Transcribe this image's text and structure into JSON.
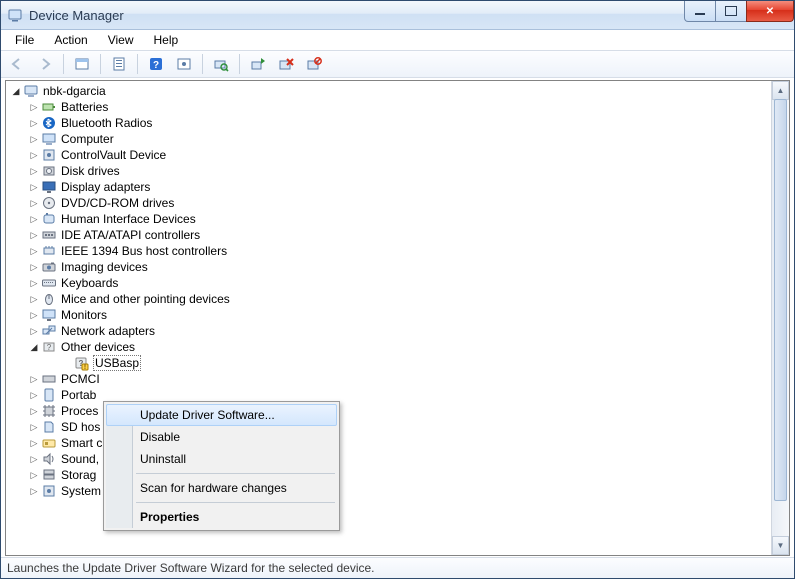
{
  "window": {
    "title": "Device Manager"
  },
  "menu": {
    "items": [
      "File",
      "Action",
      "View",
      "Help"
    ]
  },
  "toolbar": {
    "buttons": [
      {
        "name": "back-icon",
        "disabled": true
      },
      {
        "name": "forward-icon",
        "disabled": true
      },
      {
        "sep": true
      },
      {
        "name": "show-hidden-icon"
      },
      {
        "sep": true
      },
      {
        "name": "properties-icon"
      },
      {
        "sep": true
      },
      {
        "name": "help-icon"
      },
      {
        "name": "toolbar-action-icon"
      },
      {
        "sep": true
      },
      {
        "name": "scan-hardware-icon"
      },
      {
        "sep": true
      },
      {
        "name": "update-driver-icon"
      },
      {
        "name": "uninstall-icon"
      },
      {
        "name": "disable-icon"
      }
    ]
  },
  "tree": {
    "root": "nbk-dgarcia",
    "nodes": [
      {
        "label": "Batteries",
        "icon": "battery-icon"
      },
      {
        "label": "Bluetooth Radios",
        "icon": "bluetooth-icon"
      },
      {
        "label": "Computer",
        "icon": "computer-icon"
      },
      {
        "label": "ControlVault Device",
        "icon": "device-icon"
      },
      {
        "label": "Disk drives",
        "icon": "disk-icon"
      },
      {
        "label": "Display adapters",
        "icon": "display-icon"
      },
      {
        "label": "DVD/CD-ROM drives",
        "icon": "cdrom-icon"
      },
      {
        "label": "Human Interface Devices",
        "icon": "hid-icon"
      },
      {
        "label": "IDE ATA/ATAPI controllers",
        "icon": "ide-icon"
      },
      {
        "label": "IEEE 1394 Bus host controllers",
        "icon": "ieee1394-icon"
      },
      {
        "label": "Imaging devices",
        "icon": "imaging-icon"
      },
      {
        "label": "Keyboards",
        "icon": "keyboard-icon"
      },
      {
        "label": "Mice and other pointing devices",
        "icon": "mouse-icon"
      },
      {
        "label": "Monitors",
        "icon": "monitor-icon"
      },
      {
        "label": "Network adapters",
        "icon": "network-icon"
      },
      {
        "label": "Other devices",
        "icon": "other-icon",
        "expanded": true,
        "children": [
          {
            "label": "USBasp",
            "icon": "unknown-device-icon",
            "selected": true,
            "warn": true
          }
        ]
      },
      {
        "label": "PCMCI",
        "icon": "pcmcia-icon",
        "truncated": true
      },
      {
        "label": "Portab",
        "icon": "portable-icon",
        "truncated": true
      },
      {
        "label": "Proces",
        "icon": "processor-icon",
        "truncated": true
      },
      {
        "label": "SD hos",
        "icon": "sd-icon",
        "truncated": true
      },
      {
        "label": "Smart c",
        "icon": "smartcard-icon",
        "truncated": true
      },
      {
        "label": "Sound,",
        "icon": "sound-icon",
        "truncated": true
      },
      {
        "label": "Storag",
        "icon": "storage-icon",
        "truncated": true
      },
      {
        "label": "System devices",
        "icon": "system-icon",
        "truncated": true
      }
    ]
  },
  "context_menu": {
    "items": [
      {
        "label": "Update Driver Software...",
        "hover": true
      },
      {
        "label": "Disable"
      },
      {
        "label": "Uninstall"
      },
      {
        "sep": true
      },
      {
        "label": "Scan for hardware changes"
      },
      {
        "sep": true
      },
      {
        "label": "Properties",
        "bold": true
      }
    ]
  },
  "status": {
    "text": "Launches the Update Driver Software Wizard for the selected device."
  }
}
